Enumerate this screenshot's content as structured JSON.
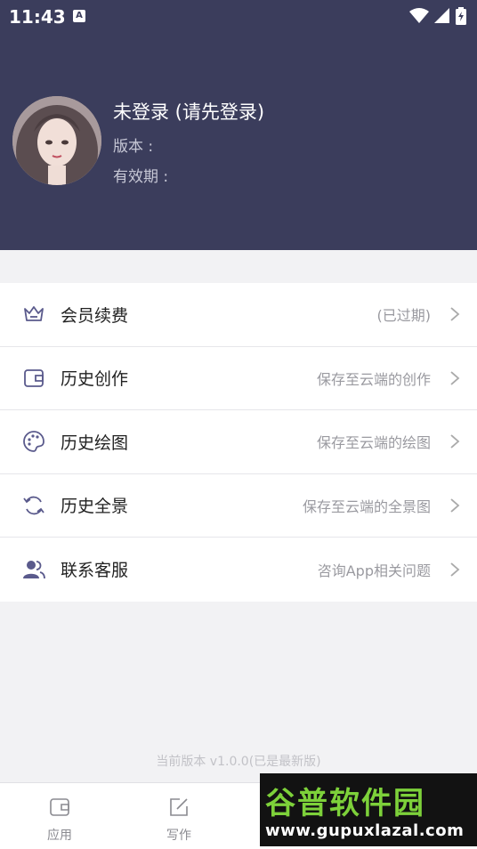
{
  "status_bar": {
    "time": "11:43",
    "notification_letter": "A"
  },
  "profile": {
    "name": "未登录 (请先登录)",
    "version_label": "版本 :",
    "expiry_label": "有效期 :"
  },
  "menu": {
    "items": [
      {
        "label": "会员续费",
        "hint": "(已过期)",
        "icon": "crown-icon"
      },
      {
        "label": "历史创作",
        "hint": "保存至云端的创作",
        "icon": "wallet-icon"
      },
      {
        "label": "历史绘图",
        "hint": "保存至云端的绘图",
        "icon": "palette-icon"
      },
      {
        "label": "历史全景",
        "hint": "保存至云端的全景图",
        "icon": "refresh-icon"
      },
      {
        "label": "联系客服",
        "hint": "咨询App相关问题",
        "icon": "users-icon"
      }
    ]
  },
  "footer": {
    "version_text": "当前版本 v1.0.0(已是最新版)"
  },
  "tabbar": {
    "tabs": [
      {
        "label": "应用",
        "icon": "wallet-icon"
      },
      {
        "label": "写作",
        "icon": "edit-icon"
      }
    ]
  },
  "watermark": {
    "brand": "谷普软件园",
    "url": "www.gupuxlazal.com"
  },
  "colors": {
    "header_bg": "#3b3d5c",
    "icon_accent": "#5a5a8c",
    "watermark_green": "#7dd13a"
  }
}
